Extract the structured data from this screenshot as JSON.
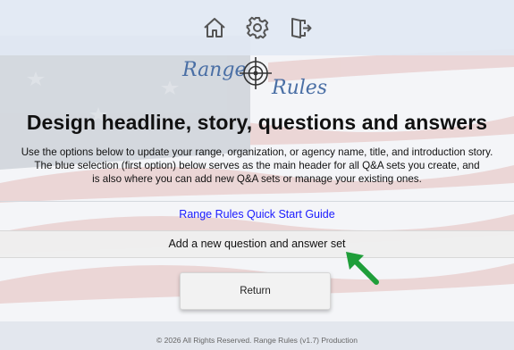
{
  "toolbar": {
    "icons": [
      "home-icon",
      "gear-icon",
      "logout-icon"
    ]
  },
  "logo": {
    "word1": "Range",
    "word2": "Rules"
  },
  "page": {
    "title": "Design headline, story, questions and answers",
    "intro_line1": "Use the options below to update your range, organization, or agency name, title, and introduction story.",
    "intro_line2": "The blue selection (first option) below serves as the main header for all Q&A sets you create, and",
    "intro_line3": "is also where you can add new Q&A sets or manage your existing ones."
  },
  "links": {
    "quick_start": "Range Rules Quick Start Guide",
    "add_set": "Add a new question and answer set"
  },
  "buttons": {
    "return_label": "Return"
  },
  "footer": {
    "text": "© 2026 All Rights Reserved. Range Rules (v1.7) Production"
  },
  "colors": {
    "link": "#1a1aff",
    "logo": "#4a6fa5",
    "arrow": "#1f9e3a"
  }
}
